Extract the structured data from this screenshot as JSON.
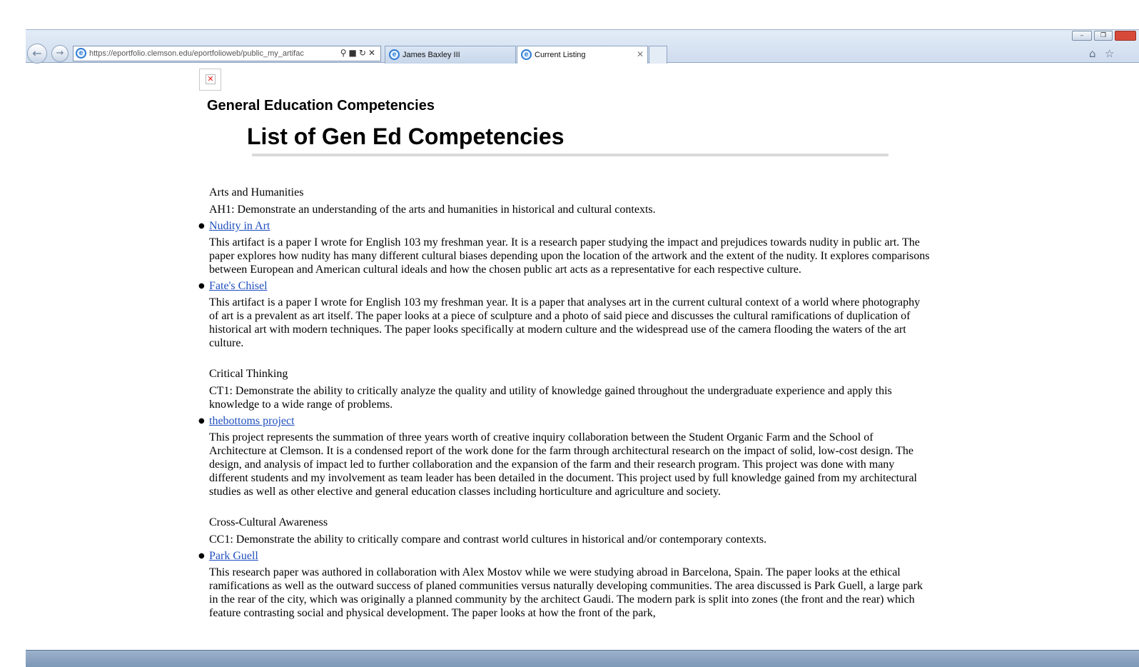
{
  "browser": {
    "address_url": "https://eportfolio.clemson.edu/eportfolioweb/public_my_artifac",
    "tabs": [
      {
        "label": "James Baxley III"
      },
      {
        "label": "Current Listing"
      }
    ],
    "icons": [
      "back-icon",
      "forward-icon",
      "ie-icon",
      "search-icon",
      "lock-icon",
      "refresh-icon",
      "stop-icon",
      "home-icon",
      "favorites-star-icon"
    ]
  },
  "page": {
    "site_title": "General Education Competencies",
    "title": "List of Gen Ed Competencies",
    "sections": [
      {
        "category": "Arts and Humanities",
        "competency": "AH1:  Demonstrate an understanding of the arts and humanities in historical and cultural contexts.",
        "items": [
          {
            "link": "Nudity in Art",
            "description": "This artifact is a paper I wrote for English 103 my freshman year. It is a research paper studying the impact and prejudices towards nudity in public art. The paper explores how nudity has many different cultural biases depending upon the location of the artwork and the extent of the nudity. It explores comparisons between European and American cultural ideals and how the chosen public art acts as a representative for each respective culture."
          },
          {
            "link": "Fate's Chisel",
            "description": "This artifact is a paper I wrote for English 103 my freshman year. It is a paper that analyses art in the current cultural context of a world where photography of art is a prevalent as art itself. The paper looks at a piece of sculpture and a photo of said piece and discusses the cultural ramifications of duplication of historical art with modern techniques. The paper looks specifically at modern culture and the widespread use of the camera flooding the waters of the art culture."
          }
        ]
      },
      {
        "category": "Critical Thinking",
        "competency": "CT1:  Demonstrate the ability to critically analyze the quality and utility of knowledge gained throughout the undergraduate experience and apply this knowledge to a wide range of problems.",
        "items": [
          {
            "link": "thebottoms project",
            "description": "This project represents the summation of three years worth of creative inquiry collaboration between the Student Organic Farm and the School of Architecture at Clemson. It is a condensed report of the work done for the farm through architectural research on the impact of solid, low-cost design. The design, and analysis of impact led to further collaboration and the expansion of the farm and their research program. This project was done with many different students and my involvement as team leader has been detailed in the document. This project used by full knowledge gained from my architectural studies as well as other elective and general education classes including horticulture and agriculture and society."
          }
        ]
      },
      {
        "category": "Cross-Cultural Awareness",
        "competency": "CC1:  Demonstrate the ability to critically compare and contrast world cultures in historical and/or contemporary contexts.",
        "items": [
          {
            "link": "Park Guell",
            "description": "This research paper was authored in collaboration with Alex Mostov while we were studying abroad in Barcelona, Spain. The paper looks at the ethical ramifications as well as the outward success of planed communities versus naturally developing communities. The area discussed is Park Guell, a large park in the rear of the city, which was originally a planned community by the architect Gaudi. The modern park is split into zones (the front and the rear) which feature contrasting social and physical development. The paper looks at how the front of the park,"
          }
        ]
      }
    ]
  }
}
